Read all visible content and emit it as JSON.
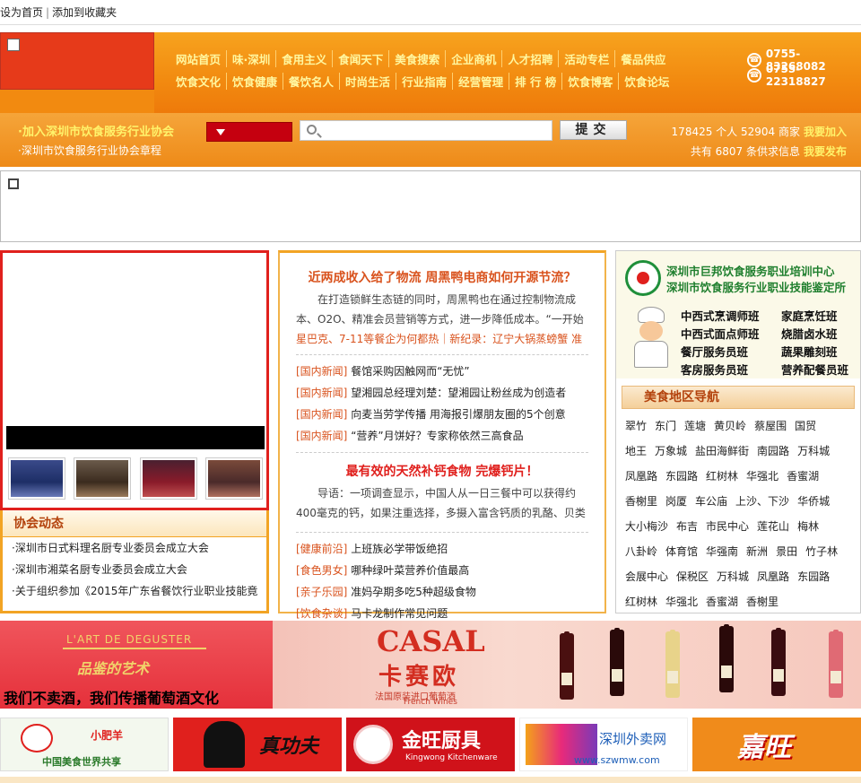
{
  "topbar": {
    "home": "设为首页",
    "sep": "|",
    "fav": "添加到收藏夹"
  },
  "nav": {
    "row1": [
      "网站首页",
      "味·深圳",
      "食用主义",
      "食闻天下",
      "美食搜索",
      "企业商机",
      "人才招聘",
      "活动专栏",
      "餐品供应"
    ],
    "row2": [
      "饮食文化",
      "饮食健康",
      "餐饮名人",
      "时尚生活",
      "行业指南",
      "经营管理",
      "排 行 榜",
      "饮食博客",
      "饮食论坛"
    ]
  },
  "phones": [
    "0755-83268082",
    "0755-22318827"
  ],
  "strip": {
    "join": "·加入深圳市饮食服务行业协会",
    "rule": "·深圳市饮食服务行业协会章程",
    "submit": "提交",
    "stats_line1": "178425 个人  52904 商家",
    "stats_line1_link": "我要加入",
    "stats_line2": "共有  6807 条供求信息",
    "stats_line2_link": "我要发布"
  },
  "assoc": {
    "title": "协会动态",
    "items": [
      "·深圳市日式料理名厨专业委员会成立大会",
      "·深圳市湘菜名厨专业委员会成立大会",
      "·关于组织参加《2015年广东省餐饮行业职业技能竟"
    ]
  },
  "news": {
    "headline1": "近两成收入给了物流  周黑鸭电商如何开源节流？",
    "para1": "在打造锁鲜生态链的同时，周黑鸭也在通过控制物流成本、O2O、精准会员营销等方式，进一步降低成本。“一开始",
    "link1": "星巴克、7-11等餐企为何都热",
    "link1sep": "｜",
    "link2": "新纪录：辽宁大锅蒸螃蟹 准",
    "list1": [
      {
        "cat": "[国内新闻]",
        "text": "餐馆采购因触网而“无忧”"
      },
      {
        "cat": "[国内新闻]",
        "text": "望湘园总经理刘楚：望湘园让粉丝成为创造者"
      },
      {
        "cat": "[国内新闻]",
        "text": "向麦当劳学传播 用海报引爆朋友圈的5个创意"
      },
      {
        "cat": "[国内新闻]",
        "text": "“营养”月饼好？专家称依然三高食品"
      }
    ],
    "headline2": "最有效的天然补钙食物  完爆钙片！",
    "para2": "导语：一项调查显示，中国人从一日三餐中可以获得约400毫克的钙，如果注重选择，多摄入富含钙质的乳酪、贝类",
    "list2": [
      {
        "cat": "[健康前沿]",
        "text": "上班族必学带饭绝招"
      },
      {
        "cat": "[食色男女]",
        "text": "哪种绿叶菜营养价值最高"
      },
      {
        "cat": "[亲子乐园]",
        "text": "准妈孕期多吃5种超级食物"
      },
      {
        "cat": "[饮食杂谈]",
        "text": "马卡龙制作常见问题"
      }
    ]
  },
  "promo": {
    "line1": "深圳市巨邦饮食服务职业培训中心",
    "line2": "深圳市饮食服务行业职业技能鉴定所",
    "courses": [
      "中西式烹调师班",
      "家庭烹饪班",
      "中西式面点师班",
      "烧腊卤水班",
      "餐厅服务员班",
      "蔬果雕刻班",
      "客房服务员班",
      "营养配餐员班"
    ]
  },
  "regions": {
    "title": "美食地区导航",
    "rows": [
      [
        "翠竹",
        "东门",
        "莲塘",
        "黄贝岭",
        "蔡屋围",
        "国贸"
      ],
      [
        "地王",
        "万象城",
        "盐田海鲜街",
        "南园路",
        "万科城"
      ],
      [
        "凤凰路",
        "东园路",
        "红树林",
        "华强北",
        "香蜜湖"
      ],
      [
        "香榭里",
        "岗厦",
        "车公庙",
        "上沙、下沙",
        "华侨城"
      ],
      [
        "大小梅沙",
        "布吉",
        "市民中心",
        "莲花山",
        "梅林"
      ],
      [
        "八卦岭",
        "体育馆",
        "华强南",
        "新洲",
        "景田",
        "竹子林"
      ],
      [
        "会展中心",
        "保税区",
        "万科城",
        "凤凰路",
        "东园路"
      ],
      [
        "红树林",
        "华强北",
        "香蜜湖",
        "香榭里"
      ]
    ]
  },
  "banner": {
    "en": "L'ART DE DEGUSTER",
    "pj": "品鉴的艺术",
    "slogan": "我们不卖酒，我们传播葡萄酒文化",
    "casal": "CASAL",
    "kse": "卡赛欧",
    "fr": "法国原装进口葡萄酒",
    "fw": "French Wines"
  },
  "logos": {
    "l1a": "小肥羊",
    "l1b": "中国美食世界共享",
    "l2": "真功夫",
    "l3a": "金旺厨具",
    "l3b": "Kingwong Kitchenware",
    "l4a": "深圳外卖网",
    "l4b": "www.szwmw.com",
    "l5": "嘉旺"
  }
}
